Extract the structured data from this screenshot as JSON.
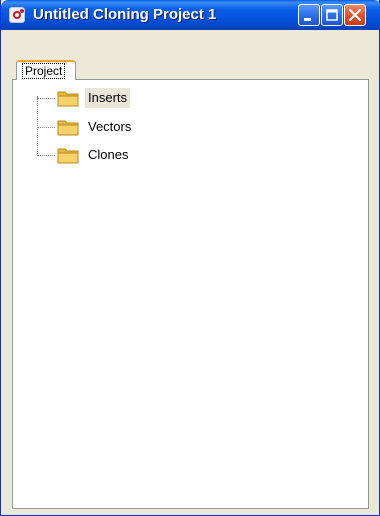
{
  "window": {
    "title": "Untitled Cloning Project 1"
  },
  "tabs": [
    {
      "label": "Project",
      "active": true
    }
  ],
  "tree": {
    "items": [
      {
        "label": "Inserts",
        "icon": "folder-icon",
        "selected": true
      },
      {
        "label": "Vectors",
        "icon": "folder-icon",
        "selected": false
      },
      {
        "label": "Clones",
        "icon": "folder-icon",
        "selected": false
      }
    ]
  },
  "colors": {
    "titlebar": "#0554dd",
    "tab_accent": "#f2a32a",
    "folder": "#f5d26a"
  }
}
